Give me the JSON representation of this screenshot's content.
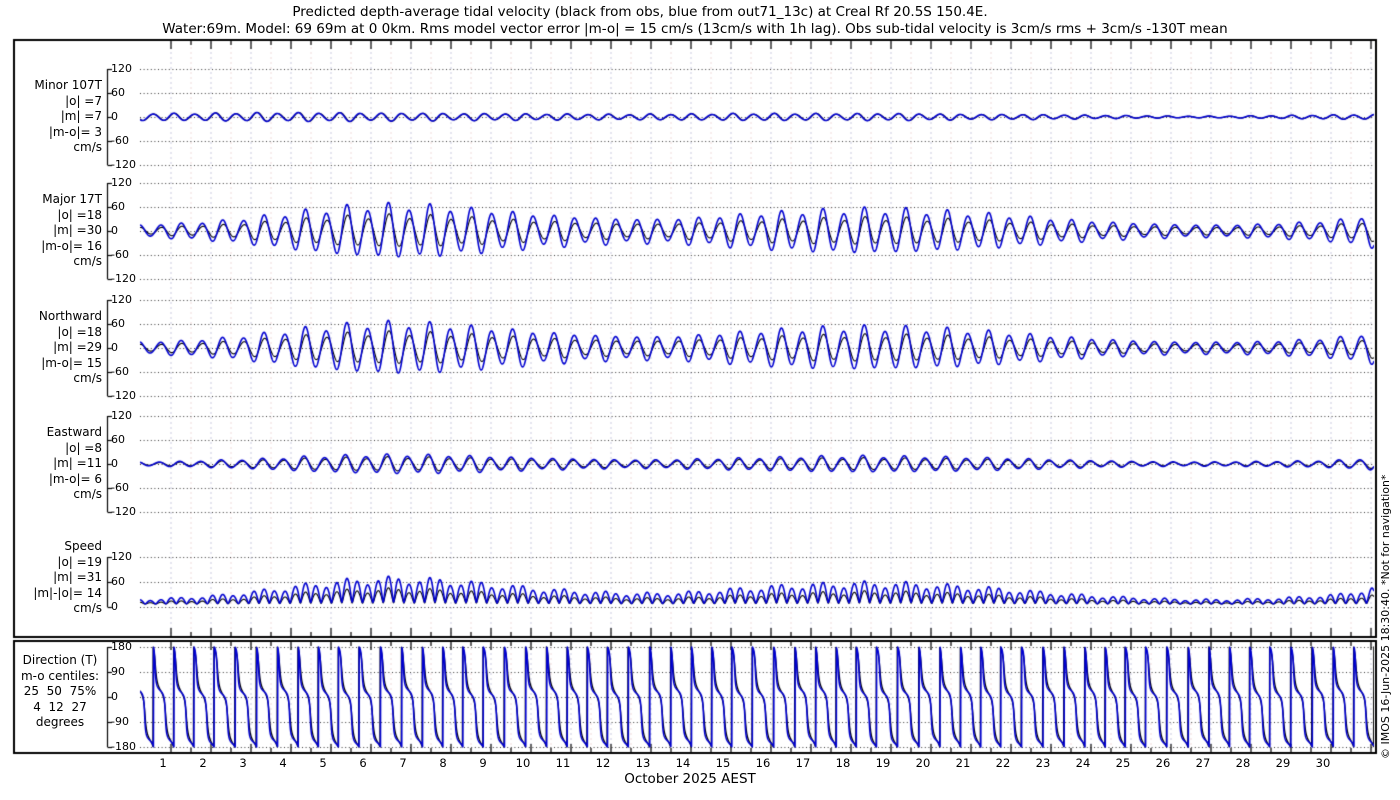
{
  "title": {
    "line1": "Predicted depth-average tidal velocity (black from obs, blue from out71_13c) at Creal Rf 20.5S 150.4E.",
    "line2": "Water:69m. Model: 69 69m at 0 0km. Rms model vector error |m-o| = 15 cm/s (13cm/s with 1h lag). Obs sub-tidal velocity is 3cm/s rms + 3cm/s -130T mean"
  },
  "watermark": "© IMOS 16-Jun-2025 18:30:40. *Not for navigation*",
  "x_axis": {
    "days": [
      1,
      2,
      3,
      4,
      5,
      6,
      7,
      8,
      9,
      10,
      11,
      12,
      13,
      14,
      15,
      16,
      17,
      18,
      19,
      20,
      21,
      22,
      23,
      24,
      25,
      26,
      27,
      28,
      29,
      30
    ],
    "month_label": "October 2025 AEST"
  },
  "colors": {
    "model_blue": "#0000d0",
    "obs_black": "#000000",
    "day_gridline": "#c9c9de",
    "noon_gridline": "#efdada",
    "dotted_gridline": "#1a1a1a"
  },
  "chart_data": {
    "type": "line",
    "x_range_days": [
      0,
      30.85
    ],
    "tidal_period_hours": 12.42,
    "diurnal_period_days": 1.0758,
    "series": [
      {
        "name": "observations (black)",
        "color": "#000000"
      },
      {
        "name": "model out71_13c (blue)",
        "color": "#0000d0"
      }
    ],
    "panels": [
      {
        "id": "minor",
        "kind": "velocity",
        "label_lines": [
          "Minor 107T",
          "|o| =7",
          "|m| =7",
          "|m-o|= 3",
          "cm/s"
        ],
        "yticks": [
          120,
          60,
          0,
          -60,
          -120
        ],
        "ylim": [
          -130,
          130
        ],
        "units": "cm/s",
        "model_envelope_by_day": [
          9,
          8,
          9,
          10,
          10,
          10,
          9,
          9,
          8,
          8,
          7,
          7,
          6,
          7,
          7,
          8,
          8,
          8,
          8,
          8,
          7,
          6,
          6,
          5,
          4,
          3,
          2,
          2,
          3,
          4,
          5,
          6
        ],
        "obs_to_model_ratio": 1.0
      },
      {
        "id": "major",
        "kind": "velocity",
        "label_lines": [
          "Major 17T",
          "|o| =18",
          "|m| =30",
          "|m-o|= 16",
          "cm/s"
        ],
        "yticks": [
          120,
          60,
          0,
          -60,
          -120
        ],
        "ylim": [
          -130,
          130
        ],
        "units": "cm/s",
        "model_envelope_by_day": [
          14,
          18,
          24,
          34,
          46,
          56,
          62,
          61,
          55,
          47,
          39,
          33,
          29,
          28,
          32,
          39,
          45,
          49,
          52,
          51,
          47,
          42,
          35,
          28,
          22,
          18,
          15,
          14,
          16,
          20,
          26,
          44
        ],
        "obs_to_model_ratio": 0.6
      },
      {
        "id": "northward",
        "kind": "velocity",
        "label_lines": [
          "Northward",
          "|o| =18",
          "|m| =29",
          "|m-o|= 15",
          "cm/s"
        ],
        "yticks": [
          120,
          60,
          0,
          -60,
          -120
        ],
        "ylim": [
          -130,
          130
        ],
        "units": "cm/s",
        "model_envelope_by_day": [
          14,
          17,
          23,
          33,
          45,
          54,
          60,
          59,
          53,
          46,
          38,
          32,
          28,
          27,
          31,
          38,
          44,
          48,
          50,
          49,
          46,
          41,
          34,
          27,
          21,
          17,
          14,
          14,
          15,
          19,
          25,
          42
        ],
        "obs_to_model_ratio": 0.62
      },
      {
        "id": "eastward",
        "kind": "velocity",
        "label_lines": [
          "Eastward",
          "|o| =8",
          "|m| =11",
          "|m-o|= 6",
          "cm/s"
        ],
        "yticks": [
          120,
          60,
          0,
          -60,
          -120
        ],
        "ylim": [
          -130,
          130
        ],
        "units": "cm/s",
        "model_envelope_by_day": [
          5,
          6,
          9,
          12,
          17,
          20,
          22,
          22,
          20,
          17,
          14,
          12,
          10,
          10,
          12,
          14,
          16,
          18,
          19,
          18,
          17,
          15,
          13,
          10,
          8,
          6,
          5,
          5,
          6,
          7,
          9,
          16
        ],
        "obs_to_model_ratio": 0.73
      },
      {
        "id": "speed",
        "kind": "speed",
        "label_lines": [
          "Speed",
          "|o| =19",
          "|m| =31",
          "|m|-|o|= 14",
          "cm/s"
        ],
        "yticks": [
          120,
          60,
          0
        ],
        "ylim": [
          0,
          130
        ],
        "units": "cm/s",
        "obs_to_model_ratio": 0.61
      },
      {
        "id": "direction",
        "kind": "direction",
        "label_lines": [
          "Direction (T)",
          "m-o centiles:",
          "25  50  75%",
          "4  12  27",
          "degrees"
        ],
        "yticks": [
          180,
          90,
          0,
          -90,
          -180
        ],
        "ylim": [
          -180,
          180
        ],
        "units": "degrees",
        "major_axis_deg": 17,
        "model_ellipse_ratio": 0.22,
        "obs_ellipse_ratio": 0.38
      }
    ]
  }
}
